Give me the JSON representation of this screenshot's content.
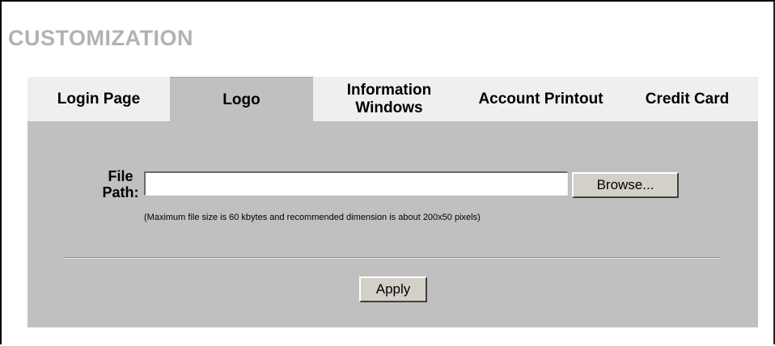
{
  "page": {
    "title": "CUSTOMIZATION"
  },
  "tabs": [
    {
      "label": "Login Page",
      "active": false
    },
    {
      "label": "Logo",
      "active": true
    },
    {
      "label": "Information Windows",
      "active": false
    },
    {
      "label": "Account Printout",
      "active": false
    },
    {
      "label": "Credit Card",
      "active": false
    }
  ],
  "form": {
    "file_path_label": "File Path:",
    "file_path_value": "",
    "browse_label": "Browse...",
    "hint": "(Maximum file size is 60 kbytes and recommended dimension is about 200x50 pixels)",
    "apply_label": "Apply"
  },
  "colors": {
    "title": "#b2b2b2",
    "panel": "#c0c0c0",
    "tab_inactive": "#efefef",
    "tab_active": "#c0c0c0"
  }
}
